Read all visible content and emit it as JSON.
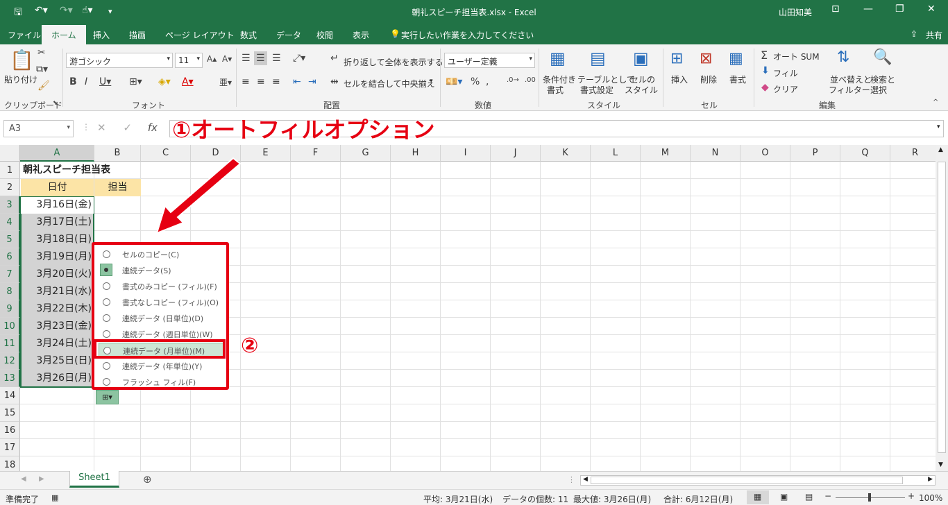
{
  "titlebar": {
    "title": "朝礼スピーチ担当表.xlsx  -  Excel",
    "user": "山田知美"
  },
  "tabs": [
    "ファイル",
    "ホーム",
    "挿入",
    "描画",
    "ページ レイアウト",
    "数式",
    "データ",
    "校閲",
    "表示"
  ],
  "tell_me": "実行したい作業を入力してください",
  "share": "共有",
  "ribbon": {
    "paste": "貼り付け",
    "font_name": "游ゴシック",
    "font_size": "11",
    "wrap_text": "折り返して全体を表示する",
    "merge_center": "セルを結合して中央揃え",
    "number_format": "ユーザー定義",
    "cond_format_1": "条件付き",
    "cond_format_2": "書式",
    "table_format_1": "テーブルとして",
    "table_format_2": "書式設定",
    "cell_style_1": "セルの",
    "cell_style_2": "スタイル",
    "insert": "挿入",
    "delete": "削除",
    "format": "書式",
    "autosum": "オート SUM",
    "fill": "フィル",
    "clear": "クリア",
    "sort_1": "並べ替えと",
    "sort_2": "フィルター",
    "find_1": "検索と",
    "find_2": "選択",
    "groups": {
      "clipboard": "クリップボード",
      "font": "フォント",
      "alignment": "配置",
      "number": "数値",
      "styles": "スタイル",
      "cells": "セル",
      "editing": "編集"
    }
  },
  "namebox": "A3",
  "formula_callout": "①オートフィルオプション",
  "columns": [
    "A",
    "B",
    "C",
    "D",
    "E",
    "F",
    "G",
    "H",
    "I",
    "J",
    "K",
    "L",
    "M",
    "N",
    "O",
    "P",
    "Q",
    "R"
  ],
  "rows": [
    "1",
    "2",
    "3",
    "4",
    "5",
    "6",
    "7",
    "8",
    "9",
    "10",
    "11",
    "12",
    "13",
    "14",
    "15",
    "16",
    "17",
    "18"
  ],
  "sheet": {
    "title": "朝礼スピーチ担当表",
    "header_date": "日付",
    "header_person": "担当",
    "dates": [
      "3月16日(金)",
      "3月17日(土)",
      "3月18日(日)",
      "3月19日(月)",
      "3月20日(火)",
      "3月21日(水)",
      "3月22日(木)",
      "3月23日(金)",
      "3月24日(土)",
      "3月25日(日)",
      "3月26日(月)"
    ]
  },
  "autofill_options": [
    {
      "label": "セルのコピー(C)",
      "checked": false
    },
    {
      "label": "連続データ(S)",
      "checked": true
    },
    {
      "label": "書式のみコピー (フィル)(F)",
      "checked": false
    },
    {
      "label": "書式なしコピー (フィル)(O)",
      "checked": false
    },
    {
      "label": "連続データ (日単位)(D)",
      "checked": false
    },
    {
      "label": "連続データ (週日単位)(W)",
      "checked": false
    },
    {
      "label": "連続データ (月単位)(M)",
      "checked": false
    },
    {
      "label": "連続データ (年単位)(Y)",
      "checked": false
    },
    {
      "label": "フラッシュ フィル(F)",
      "checked": false
    }
  ],
  "callout2": "②",
  "sheet_tab": "Sheet1",
  "status": {
    "ready": "準備完了",
    "average": "平均: 3月21日(水)",
    "count": "データの個数: 11",
    "max": "最大値: 3月26日(月)",
    "sum": "合計: 6月12日(月)",
    "zoom": "100%"
  },
  "colors": {
    "excel_green": "#217346",
    "highlight_red": "#e60012",
    "header_fill": "#fce4a6"
  }
}
